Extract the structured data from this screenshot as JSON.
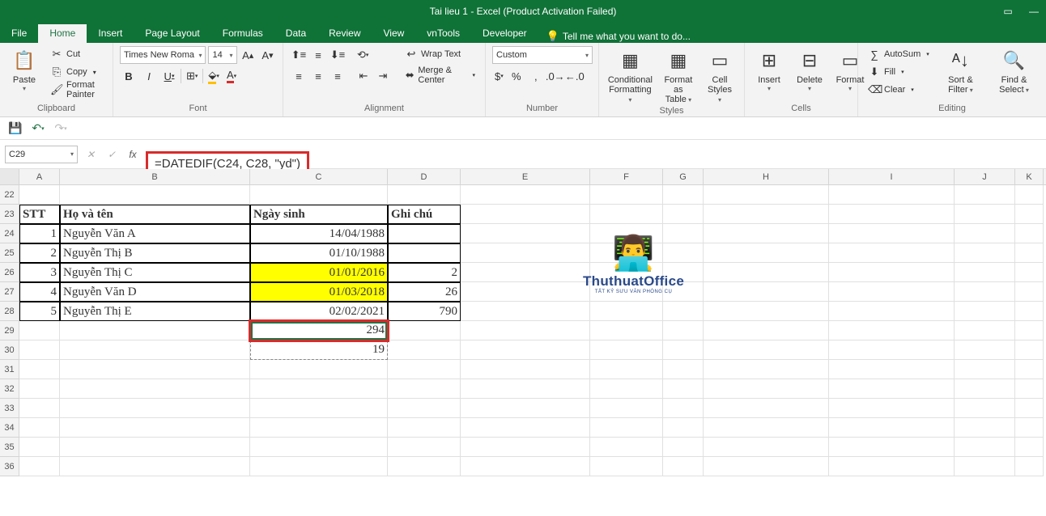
{
  "titlebar": {
    "title": "Tai lieu 1 - Excel (Product Activation Failed)"
  },
  "tabs": {
    "file": "File",
    "home": "Home",
    "insert": "Insert",
    "pageLayout": "Page Layout",
    "formulas": "Formulas",
    "data": "Data",
    "review": "Review",
    "view": "View",
    "vntools": "vnTools",
    "developer": "Developer",
    "tell": "Tell me what you want to do..."
  },
  "ribbon": {
    "clipboard": {
      "paste": "Paste",
      "cut": "Cut",
      "copy": "Copy",
      "fp": "Format Painter",
      "label": "Clipboard"
    },
    "font": {
      "name": "Times New Roma",
      "size": "14",
      "b": "B",
      "i": "I",
      "u": "U",
      "label": "Font"
    },
    "alignment": {
      "wrap": "Wrap Text",
      "merge": "Merge & Center",
      "label": "Alignment"
    },
    "number": {
      "format": "Custom",
      "label": "Number"
    },
    "styles": {
      "cf": "Conditional Formatting",
      "fat": "Format as Table",
      "cs": "Cell Styles",
      "label": "Styles"
    },
    "cells": {
      "insert": "Insert",
      "delete": "Delete",
      "format": "Format",
      "label": "Cells"
    },
    "editing": {
      "sum": "AutoSum",
      "fill": "Fill",
      "clear": "Clear",
      "sort": "Sort & Filter",
      "find": "Find & Select",
      "label": "Editing"
    }
  },
  "nameBox": "C29",
  "formula": "=DATEDIF(C24, C28, \"yd\")",
  "cols": {
    "A": 50,
    "B": 235,
    "C": 170,
    "D": 90,
    "E": 160,
    "F": 90,
    "G": 50,
    "H": 155,
    "I": 155,
    "J": 75,
    "K": 35
  },
  "rows": [
    22,
    23,
    24,
    25,
    26,
    27,
    28,
    29,
    30,
    31,
    32,
    33,
    34,
    35,
    36
  ],
  "data": {
    "headers": {
      "stt": "STT",
      "hoten": "Họ và tên",
      "ngaysinh": "Ngày sinh",
      "ghichu": "Ghi chú"
    },
    "table": [
      {
        "stt": "1",
        "name": "Nguyễn Văn A",
        "dob": "14/04/1988",
        "note": ""
      },
      {
        "stt": "2",
        "name": "Nguyễn Thị B",
        "dob": "01/10/1988",
        "note": ""
      },
      {
        "stt": "3",
        "name": "Nguyễn Thị C",
        "dob": "01/01/2016",
        "note": "2",
        "hl": true
      },
      {
        "stt": "4",
        "name": "Nguyễn Văn D",
        "dob": "01/03/2018",
        "note": "26",
        "hl": true
      },
      {
        "stt": "5",
        "name": "Nguyễn Thị E",
        "dob": "02/02/2021",
        "note": "790"
      }
    ],
    "c29": "294",
    "c30": "19"
  },
  "watermark": {
    "text": "ThuthuatOffice",
    "sub": "TẤT KỶ SƯU VĂN PHÒNG CỤ"
  }
}
